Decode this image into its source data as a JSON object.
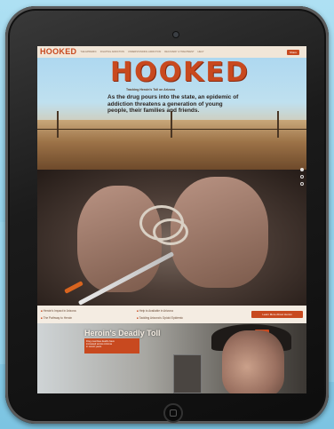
{
  "site": {
    "logo": "HOOKED",
    "nav": [
      "The Epidemic",
      "Fighting Addiction",
      "Understanding Addiction",
      "Recovery & Treatment",
      "Help"
    ],
    "nav_button": "Share"
  },
  "hero": {
    "title": "HOOKED",
    "tagline": "Tracking Heroin's Toll on Arizona",
    "intro": "As the drug pours into the state, an epidemic of addiction threatens a generation of young people, their families and friends."
  },
  "links": {
    "items": [
      "Heroin's Impact in Arizona",
      "The Pathway to Heroin",
      "Help is Available in Arizona",
      "Tackling Arizona's Opioid Epidemic"
    ],
    "button": "Learn More About Heroin"
  },
  "feature": {
    "title": "Heroin's Deadly Toll",
    "card_lines": [
      "Drug overdose deaths have",
      "increased across Arizona",
      "in recent years."
    ]
  },
  "colors": {
    "accent": "#c8491f",
    "paper": "#f1e6d8"
  },
  "icons": [
    "camera-icon",
    "home-button-icon"
  ]
}
